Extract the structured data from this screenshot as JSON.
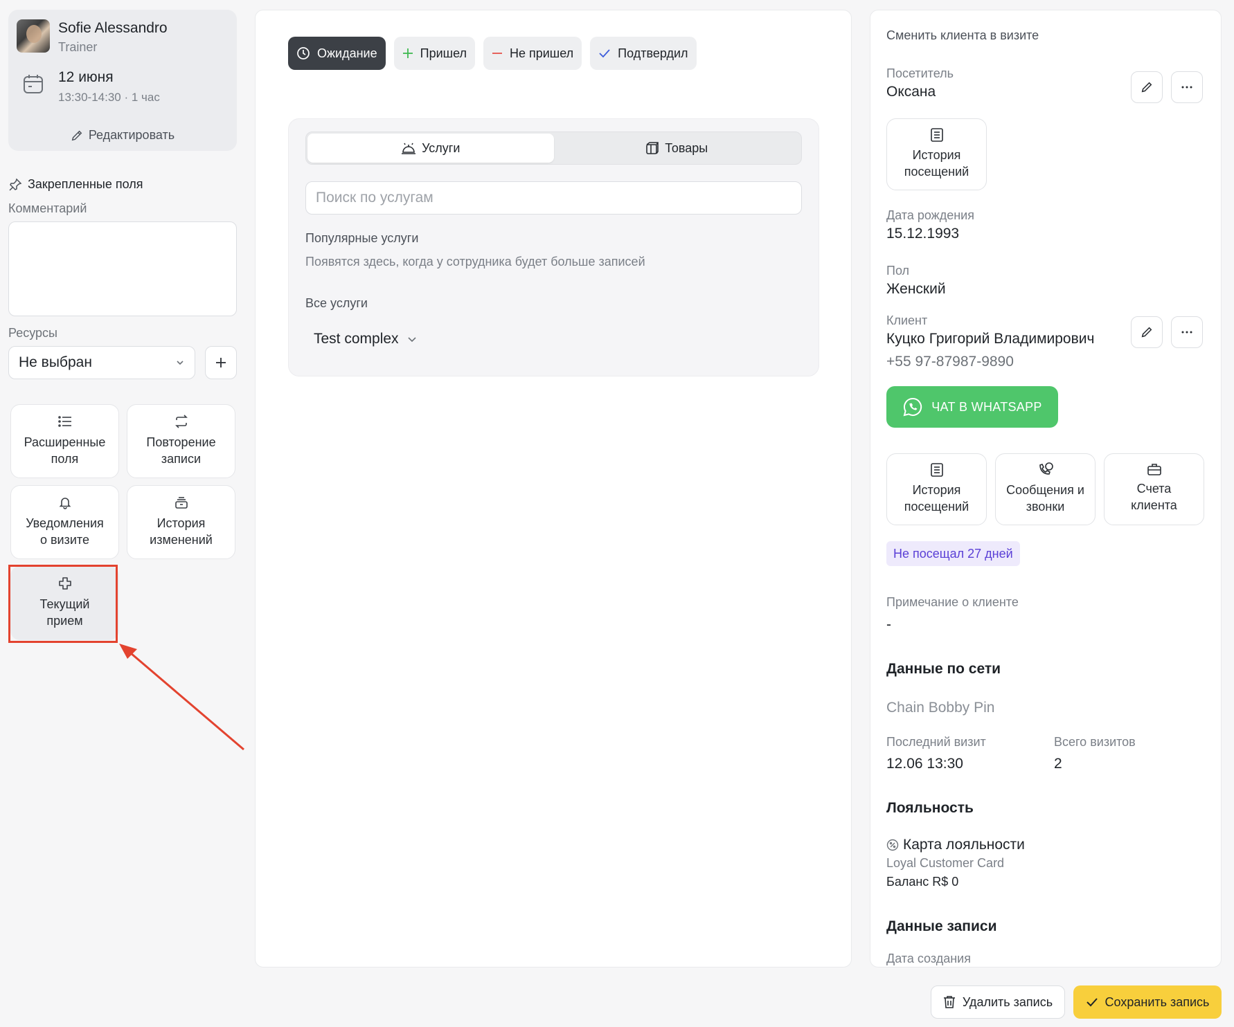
{
  "staff": {
    "name": "Sofie Alessandro",
    "role": "Trainer",
    "date": "12 июня",
    "time": "13:30-14:30 · 1 час",
    "edit_label": "Редактировать"
  },
  "pinned": {
    "title": "Закрепленные поля",
    "comment_label": "Комментарий",
    "resources_label": "Ресурсы",
    "resources_value": "Не выбран"
  },
  "tiles": [
    {
      "label": "Расширенные\nполя",
      "icon": "list-icon"
    },
    {
      "label": "Повторение\nзаписи",
      "icon": "repeat-icon"
    },
    {
      "label": "Уведомления\nо визите",
      "icon": "bell-icon"
    },
    {
      "label": "История\nизменений",
      "icon": "history-stack-icon"
    },
    {
      "label": "Текущий\nприем",
      "icon": "medical-cross-icon"
    }
  ],
  "status_buttons": [
    {
      "label": "Ожидание",
      "icon": "clock-icon",
      "active": true
    },
    {
      "label": "Пришел",
      "icon": "plus-icon",
      "color": "#3fb950"
    },
    {
      "label": "Не пришел",
      "icon": "minus-icon",
      "color": "#e5534b"
    },
    {
      "label": "Подтвердил",
      "icon": "check-icon",
      "color": "#3b5bdb"
    }
  ],
  "services": {
    "tab_services": "Услуги",
    "tab_goods": "Товары",
    "search_placeholder": "Поиск по услугам",
    "popular_label": "Популярные услуги",
    "popular_hint": "Появятся здесь, когда у сотрудника будет больше записей",
    "all_label": "Все услуги",
    "category": "Test complex"
  },
  "client": {
    "change_label": "Сменить клиента в визите",
    "visitor_label": "Посетитель",
    "visitor_name": "Оксана",
    "history_tile": "История\nпосещений",
    "birth_label": "Дата рождения",
    "birth_value": "15.12.1993",
    "gender_label": "Пол",
    "gender_value": "Женский",
    "client_label": "Клиент",
    "client_name": "Куцко Григорий Владимирович",
    "phone": "+55 97-87987-9890",
    "whatsapp_label": "ЧАТ В WHATSAPP",
    "tiles": [
      {
        "label": "История\nпосещений",
        "icon": "document-list-icon"
      },
      {
        "label": "Сообщения и\nзвонки",
        "icon": "phone-chat-icon"
      },
      {
        "label": "Счета\nклиента",
        "icon": "briefcase-icon"
      }
    ],
    "not_visited_badge": "Не посещал 27 дней",
    "note_label": "Примечание о клиенте",
    "note_value": "-",
    "network_title": "Данные по сети",
    "network_name": "Chain Bobby Pin",
    "last_visit_label": "Последний визит",
    "last_visit_value": "12.06 13:30",
    "total_visits_label": "Всего визитов",
    "total_visits_value": "2",
    "loyalty_title": "Лояльность",
    "loyalty_card_label": "Карта лояльности",
    "loyalty_card_name": "Loyal Customer Card",
    "loyalty_balance": "Баланс R$ 0",
    "record_title": "Данные записи",
    "created_label": "Дата создания"
  },
  "footer": {
    "delete_label": "Удалить запись",
    "save_label": "Сохранить запись"
  },
  "colors": {
    "highlight": "#e3432f",
    "whatsapp": "#4fc66b",
    "save": "#f8cf3c",
    "badge_text": "#5a3fd6"
  }
}
